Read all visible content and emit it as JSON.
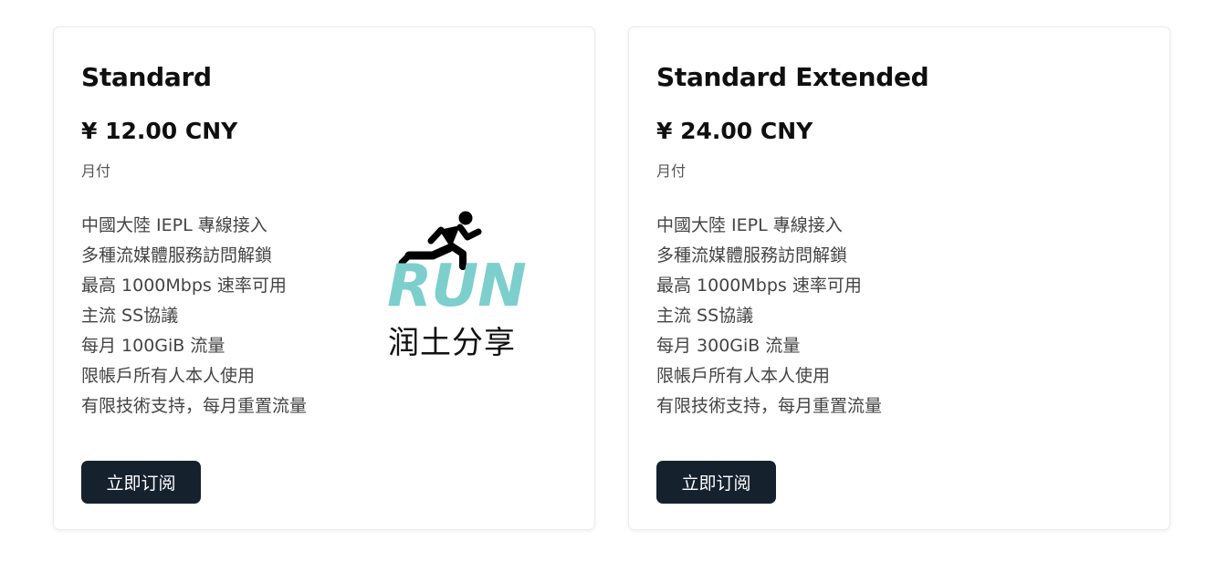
{
  "plans": [
    {
      "name": "Standard",
      "price": "¥ 12.00 CNY",
      "billing": "月付",
      "features": [
        "中國大陸 IEPL 專線接入",
        "多種流媒體服務訪問解鎖",
        "最高 1000Mbps 速率可用",
        "主流 SS協議",
        "每月 100GiB 流量",
        "限帳戶所有人本人使用",
        "有限技術支持，每月重置流量"
      ],
      "button_label": "立即订阅"
    },
    {
      "name": "Standard Extended",
      "price": "¥ 24.00 CNY",
      "billing": "月付",
      "features": [
        "中國大陸 IEPL 專線接入",
        "多種流媒體服務訪問解鎖",
        "最高 1000Mbps 速率可用",
        "主流 SS協議",
        "每月 300GiB 流量",
        "限帳戶所有人本人使用",
        "有限技術支持，每月重置流量"
      ],
      "button_label": "立即订阅"
    }
  ],
  "watermark": {
    "word": "RUN",
    "subtitle": "润土分享",
    "icon": "running-person-icon",
    "word_color": "#7ccfcc"
  },
  "colors": {
    "button_bg": "#16212e",
    "feature_text": "#444444"
  }
}
